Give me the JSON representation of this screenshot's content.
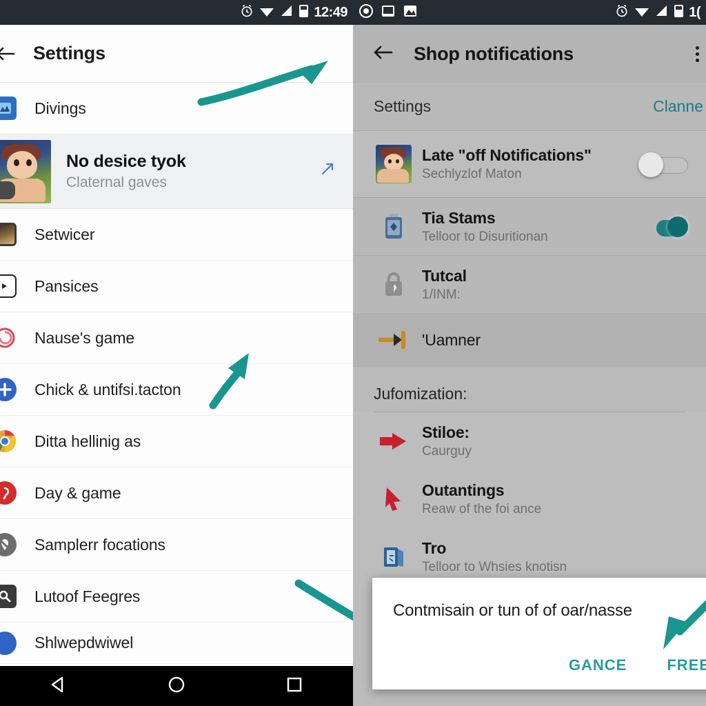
{
  "accent_teal": "#18968f",
  "accent_link": "#1c7c80",
  "left_phone": {
    "statusbar": {
      "time": "12:49",
      "icons": [
        "alarm-icon",
        "wifi-icon",
        "signal-icon",
        "battery-icon"
      ]
    },
    "appbar": {
      "back": "back-arrow-icon",
      "title": "Settings",
      "overflow": ""
    },
    "featured": {
      "title": "No desice tyok",
      "subtitle": "Claternal gaves",
      "action_icon": "external-link-icon"
    },
    "items": [
      {
        "label": "Divings",
        "icon": "app-tile-icon",
        "icon_color": "#2f6fbf"
      },
      {
        "label": "Setwicer",
        "icon": "photo-thumb-icon",
        "icon_color": "#8a6a3a"
      },
      {
        "label": "Pansices",
        "icon": "video-outline-icon",
        "icon_color": "#1f1f1f"
      },
      {
        "label": "Nause's game",
        "icon": "swirl-icon",
        "icon_color": "#d9495b"
      },
      {
        "label": "Chick & untifsi.tacton",
        "icon": "plus-circle-icon",
        "icon_color": "#2f63c4"
      },
      {
        "label": "Ditta hellinig as",
        "icon": "chrome-icon",
        "icon_color": "#e8a33d"
      },
      {
        "label": "Day & game",
        "icon": "pinterest-icon",
        "icon_color": "#d62b2b"
      },
      {
        "label": "Samplerr focations",
        "icon": "location-off-icon",
        "icon_color": "#6d6d6d"
      },
      {
        "label": "Lutoof Feegres",
        "icon": "search-wrench-icon",
        "icon_color": "#3a3a3a"
      },
      {
        "label": "Shlwepdwiwel",
        "icon": "app-circle-icon",
        "icon_color": "#2f63c4"
      }
    ],
    "navbar": {
      "back": "triangle-back-icon",
      "home": "circle-home-icon",
      "recents": "square-recents-icon"
    }
  },
  "right_phone": {
    "statusbar": {
      "time": "1(",
      "left_icons": [
        "record-icon",
        "screen-icon",
        "image-icon"
      ],
      "right_icons": [
        "alarm-icon",
        "wifi-icon",
        "signal-icon",
        "battery-icon"
      ]
    },
    "appbar": {
      "back": "back-arrow-icon",
      "title": "Shop notifications",
      "overflow": "kebab-menu-icon"
    },
    "tabs": {
      "left": "Settings",
      "right": "Clanne"
    },
    "rows": [
      {
        "title": "Late \"off Notifications\"",
        "subtitle": "Sechlyzlof Maton",
        "icon": "app-avatar-icon",
        "toggle": "off"
      },
      {
        "title": "Tia Stams",
        "subtitle": "Telloor to Disuritionan",
        "icon": "battery-blue-icon",
        "toggle": "on"
      },
      {
        "title": "Tutcal",
        "subtitle": "1/INM:",
        "icon": "lock-badge-icon",
        "toggle": "none"
      },
      {
        "title": "'Uamner",
        "subtitle": "",
        "icon": "arrow-gold-icon",
        "toggle": "none"
      }
    ],
    "section": {
      "header": "Jufomization:"
    },
    "custom_rows": [
      {
        "title": "Stiloe:",
        "subtitle": "Caurguy",
        "icon": "red-arrow-right-icon"
      },
      {
        "title": "Outantings",
        "subtitle": "Reaw of the foi ance",
        "icon": "red-cursor-icon"
      },
      {
        "title": "Tro",
        "subtitle": "Telloor to Whsies knotisn",
        "icon": "blue-folder-icon"
      }
    ],
    "dialog": {
      "message": "Contmisain or tun of of oar/nasse",
      "cancel": "GANCE",
      "confirm": "FREE"
    }
  },
  "annotations": [
    {
      "name": "arrow-to-settings-title",
      "color": "#18968f"
    },
    {
      "name": "arrow-to-list-items",
      "color": "#18968f"
    },
    {
      "name": "arrow-to-dialog",
      "color": "#18968f"
    },
    {
      "name": "arrow-to-free-button",
      "color": "#18968f"
    }
  ]
}
